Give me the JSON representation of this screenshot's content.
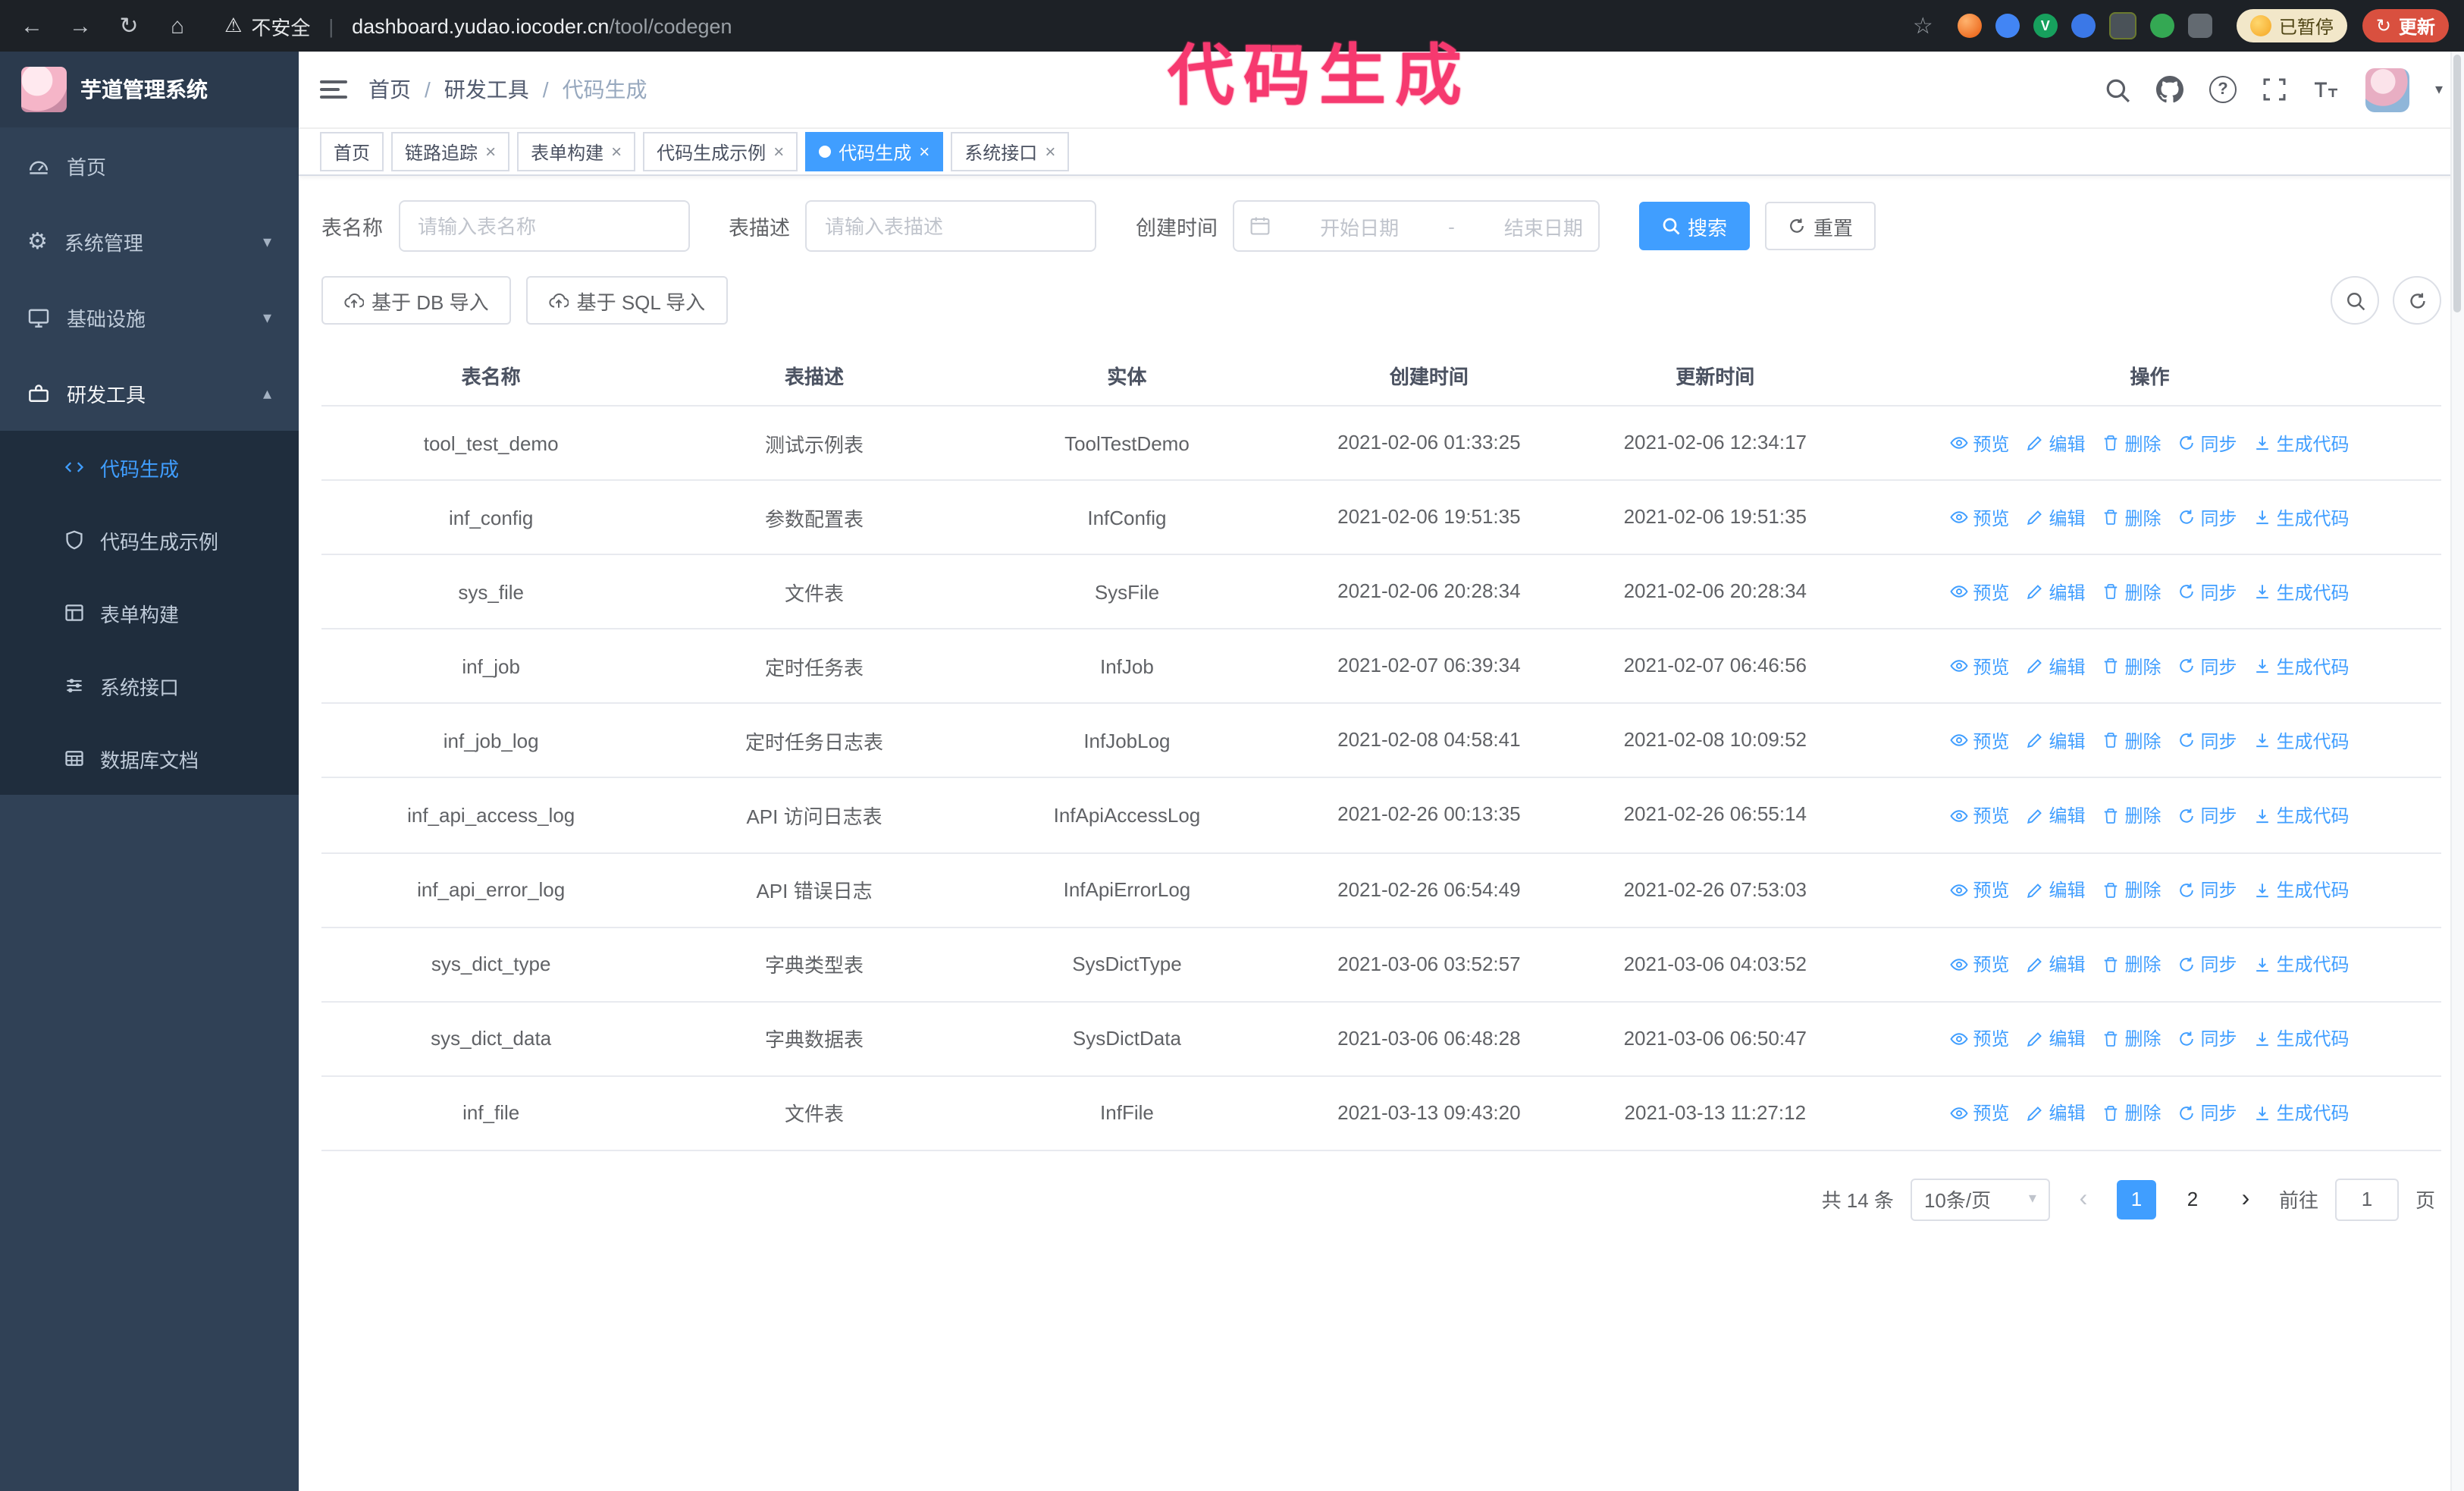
{
  "colors": {
    "accent": "#409EFF",
    "annotation": "#f6396f",
    "update_button": "#d9503f",
    "paused_badge_bg": "#f2e7c9",
    "sidebar_bg": "#304156",
    "submenu_bg": "#1f2d3d"
  },
  "annotation": {
    "text": "代码生成"
  },
  "browser": {
    "security_label": "不安全",
    "url_domain": "dashboard.yudao.iocoder.cn",
    "url_path": "/tool/codegen",
    "paused_badge": "已暂停",
    "update_button": "更新"
  },
  "glyphs": {
    "back": "←",
    "forward": "→",
    "reload": "↻",
    "home": "⌂",
    "warning": "⚠",
    "star": "☆",
    "divider": "|",
    "close": "×",
    "caret_down": "▾",
    "caret_up": "▴",
    "breadcrumb_sep": "/",
    "prev": "‹",
    "next": "›",
    "gear": "⚙",
    "question": "?",
    "check": "V"
  },
  "sidebar": {
    "logo_title": "芋道管理系统",
    "items": [
      {
        "label": "首页"
      },
      {
        "label": "系统管理"
      },
      {
        "label": "基础设施"
      },
      {
        "label": "研发工具"
      }
    ],
    "subitems": [
      {
        "label": "代码生成"
      },
      {
        "label": "代码生成示例"
      },
      {
        "label": "表单构建"
      },
      {
        "label": "系统接口"
      },
      {
        "label": "数据库文档"
      }
    ]
  },
  "header": {
    "breadcrumb": [
      "首页",
      "研发工具",
      "代码生成"
    ]
  },
  "tabs": [
    {
      "label": "首页"
    },
    {
      "label": "链路追踪"
    },
    {
      "label": "表单构建"
    },
    {
      "label": "代码生成示例"
    },
    {
      "label": "代码生成"
    },
    {
      "label": "系统接口"
    }
  ],
  "filters": {
    "table_name_label": "表名称",
    "table_name_placeholder": "请输入表名称",
    "table_desc_label": "表描述",
    "table_desc_placeholder": "请输入表描述",
    "create_time_label": "创建时间",
    "date_start_placeholder": "开始日期",
    "date_separator": "-",
    "date_end_placeholder": "结束日期",
    "search_button": "搜索",
    "reset_button": "重置"
  },
  "toolbar": {
    "import_db": "基于 DB 导入",
    "import_sql": "基于 SQL 导入"
  },
  "table": {
    "columns": [
      "表名称",
      "表描述",
      "实体",
      "创建时间",
      "更新时间",
      "操作"
    ],
    "actions": [
      "预览",
      "编辑",
      "删除",
      "同步",
      "生成代码"
    ],
    "rows": [
      {
        "name": "tool_test_demo",
        "desc": "测试示例表",
        "entity": "ToolTestDemo",
        "created": "2021-02-06 01:33:25",
        "updated": "2021-02-06 12:34:17"
      },
      {
        "name": "inf_config",
        "desc": "参数配置表",
        "entity": "InfConfig",
        "created": "2021-02-06 19:51:35",
        "updated": "2021-02-06 19:51:35"
      },
      {
        "name": "sys_file",
        "desc": "文件表",
        "entity": "SysFile",
        "created": "2021-02-06 20:28:34",
        "updated": "2021-02-06 20:28:34"
      },
      {
        "name": "inf_job",
        "desc": "定时任务表",
        "entity": "InfJob",
        "created": "2021-02-07 06:39:34",
        "updated": "2021-02-07 06:46:56"
      },
      {
        "name": "inf_job_log",
        "desc": "定时任务日志表",
        "entity": "InfJobLog",
        "created": "2021-02-08 04:58:41",
        "updated": "2021-02-08 10:09:52"
      },
      {
        "name": "inf_api_access_log",
        "desc": "API 访问日志表",
        "entity": "InfApiAccessLog",
        "created": "2021-02-26 00:13:35",
        "updated": "2021-02-26 06:55:14"
      },
      {
        "name": "inf_api_error_log",
        "desc": "API 错误日志",
        "entity": "InfApiErrorLog",
        "created": "2021-02-26 06:54:49",
        "updated": "2021-02-26 07:53:03"
      },
      {
        "name": "sys_dict_type",
        "desc": "字典类型表",
        "entity": "SysDictType",
        "created": "2021-03-06 03:52:57",
        "updated": "2021-03-06 04:03:52"
      },
      {
        "name": "sys_dict_data",
        "desc": "字典数据表",
        "entity": "SysDictData",
        "created": "2021-03-06 06:48:28",
        "updated": "2021-03-06 06:50:47"
      },
      {
        "name": "inf_file",
        "desc": "文件表",
        "entity": "InfFile",
        "created": "2021-03-13 09:43:20",
        "updated": "2021-03-13 11:27:12"
      }
    ]
  },
  "pagination": {
    "total": "共 14 条",
    "page_size": "10条/页",
    "pages": [
      "1",
      "2"
    ],
    "goto_label": "前往",
    "goto_value": "1",
    "goto_unit": "页"
  }
}
